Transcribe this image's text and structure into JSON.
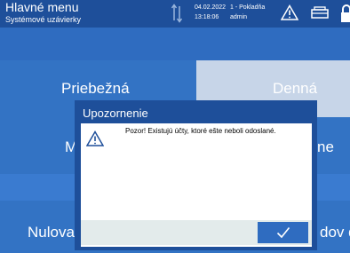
{
  "header": {
    "title": "Hlavné menu",
    "subtitle": "Systémové uzávierky",
    "date": "04.02.2022",
    "time": "13:18:06",
    "register": "1 - Pokladňa",
    "user": "admin",
    "icons": [
      "sync-icon",
      "warning-icon",
      "printer-icon",
      "lock-icon"
    ]
  },
  "tiles": {
    "priebezna": "Priebežná",
    "denna": "Denná",
    "mid_left_fragment": "M",
    "mid_right_fragment": "ne",
    "bottom_left_fragment": "Nulova",
    "bottom_right_fragment": "dov d"
  },
  "dialog": {
    "title": "Upozornenie",
    "message": "Pozor! Existujú účty, ktoré ešte neboli odoslané.",
    "icon": "warning-icon",
    "ok_icon": "check-icon"
  },
  "colors": {
    "header": "#1e4f9a",
    "tile": "#3373c4",
    "selected_tile": "#c7d5e8",
    "dialog_footer": "#e3ebeb"
  }
}
